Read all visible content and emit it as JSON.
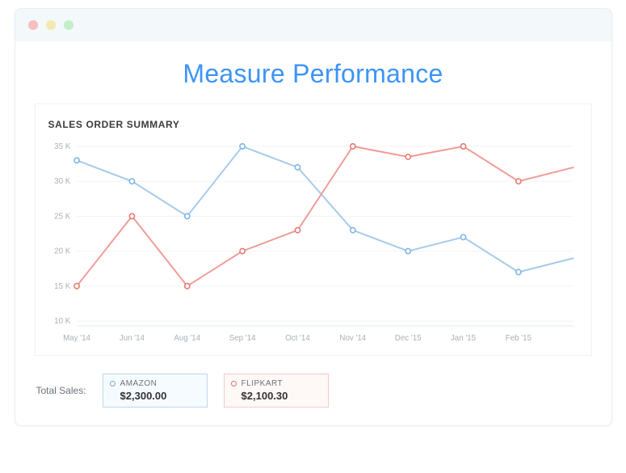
{
  "page_title": "Measure Performance",
  "card_title": "SALES ORDER SUMMARY",
  "totals_label": "Total Sales:",
  "legend": {
    "a": {
      "name": "AMAZON",
      "value": "$2,300.00"
    },
    "b": {
      "name": "FLIPKART",
      "value": "$2,100.30"
    }
  },
  "y_ticks": [
    "35 K",
    "30 K",
    "25 K",
    "20 K",
    "15 K",
    "10 K"
  ],
  "x_categories": [
    "May '14",
    "Jun '14",
    "Aug '14",
    "Sep '14",
    "Oct '14",
    "Nov '14",
    "Dec '15",
    "Jan '15",
    "Feb '15"
  ],
  "chart_data": {
    "type": "line",
    "title": "SALES ORDER SUMMARY",
    "xlabel": "",
    "ylabel": "",
    "ylim": [
      10,
      35
    ],
    "categories": [
      "May '14",
      "Jun '14",
      "Aug '14",
      "Sep '14",
      "Oct '14",
      "Nov '14",
      "Dec '15",
      "Jan '15",
      "Feb '15",
      ""
    ],
    "series": [
      {
        "name": "AMAZON",
        "color": "#7fb4e6",
        "values": [
          33,
          30,
          25,
          35,
          32,
          23,
          20,
          22,
          17,
          19
        ]
      },
      {
        "name": "FLIPKART",
        "color": "#e77a72",
        "values": [
          15,
          25,
          15,
          20,
          23,
          35,
          33.5,
          35,
          30,
          32
        ]
      }
    ]
  }
}
